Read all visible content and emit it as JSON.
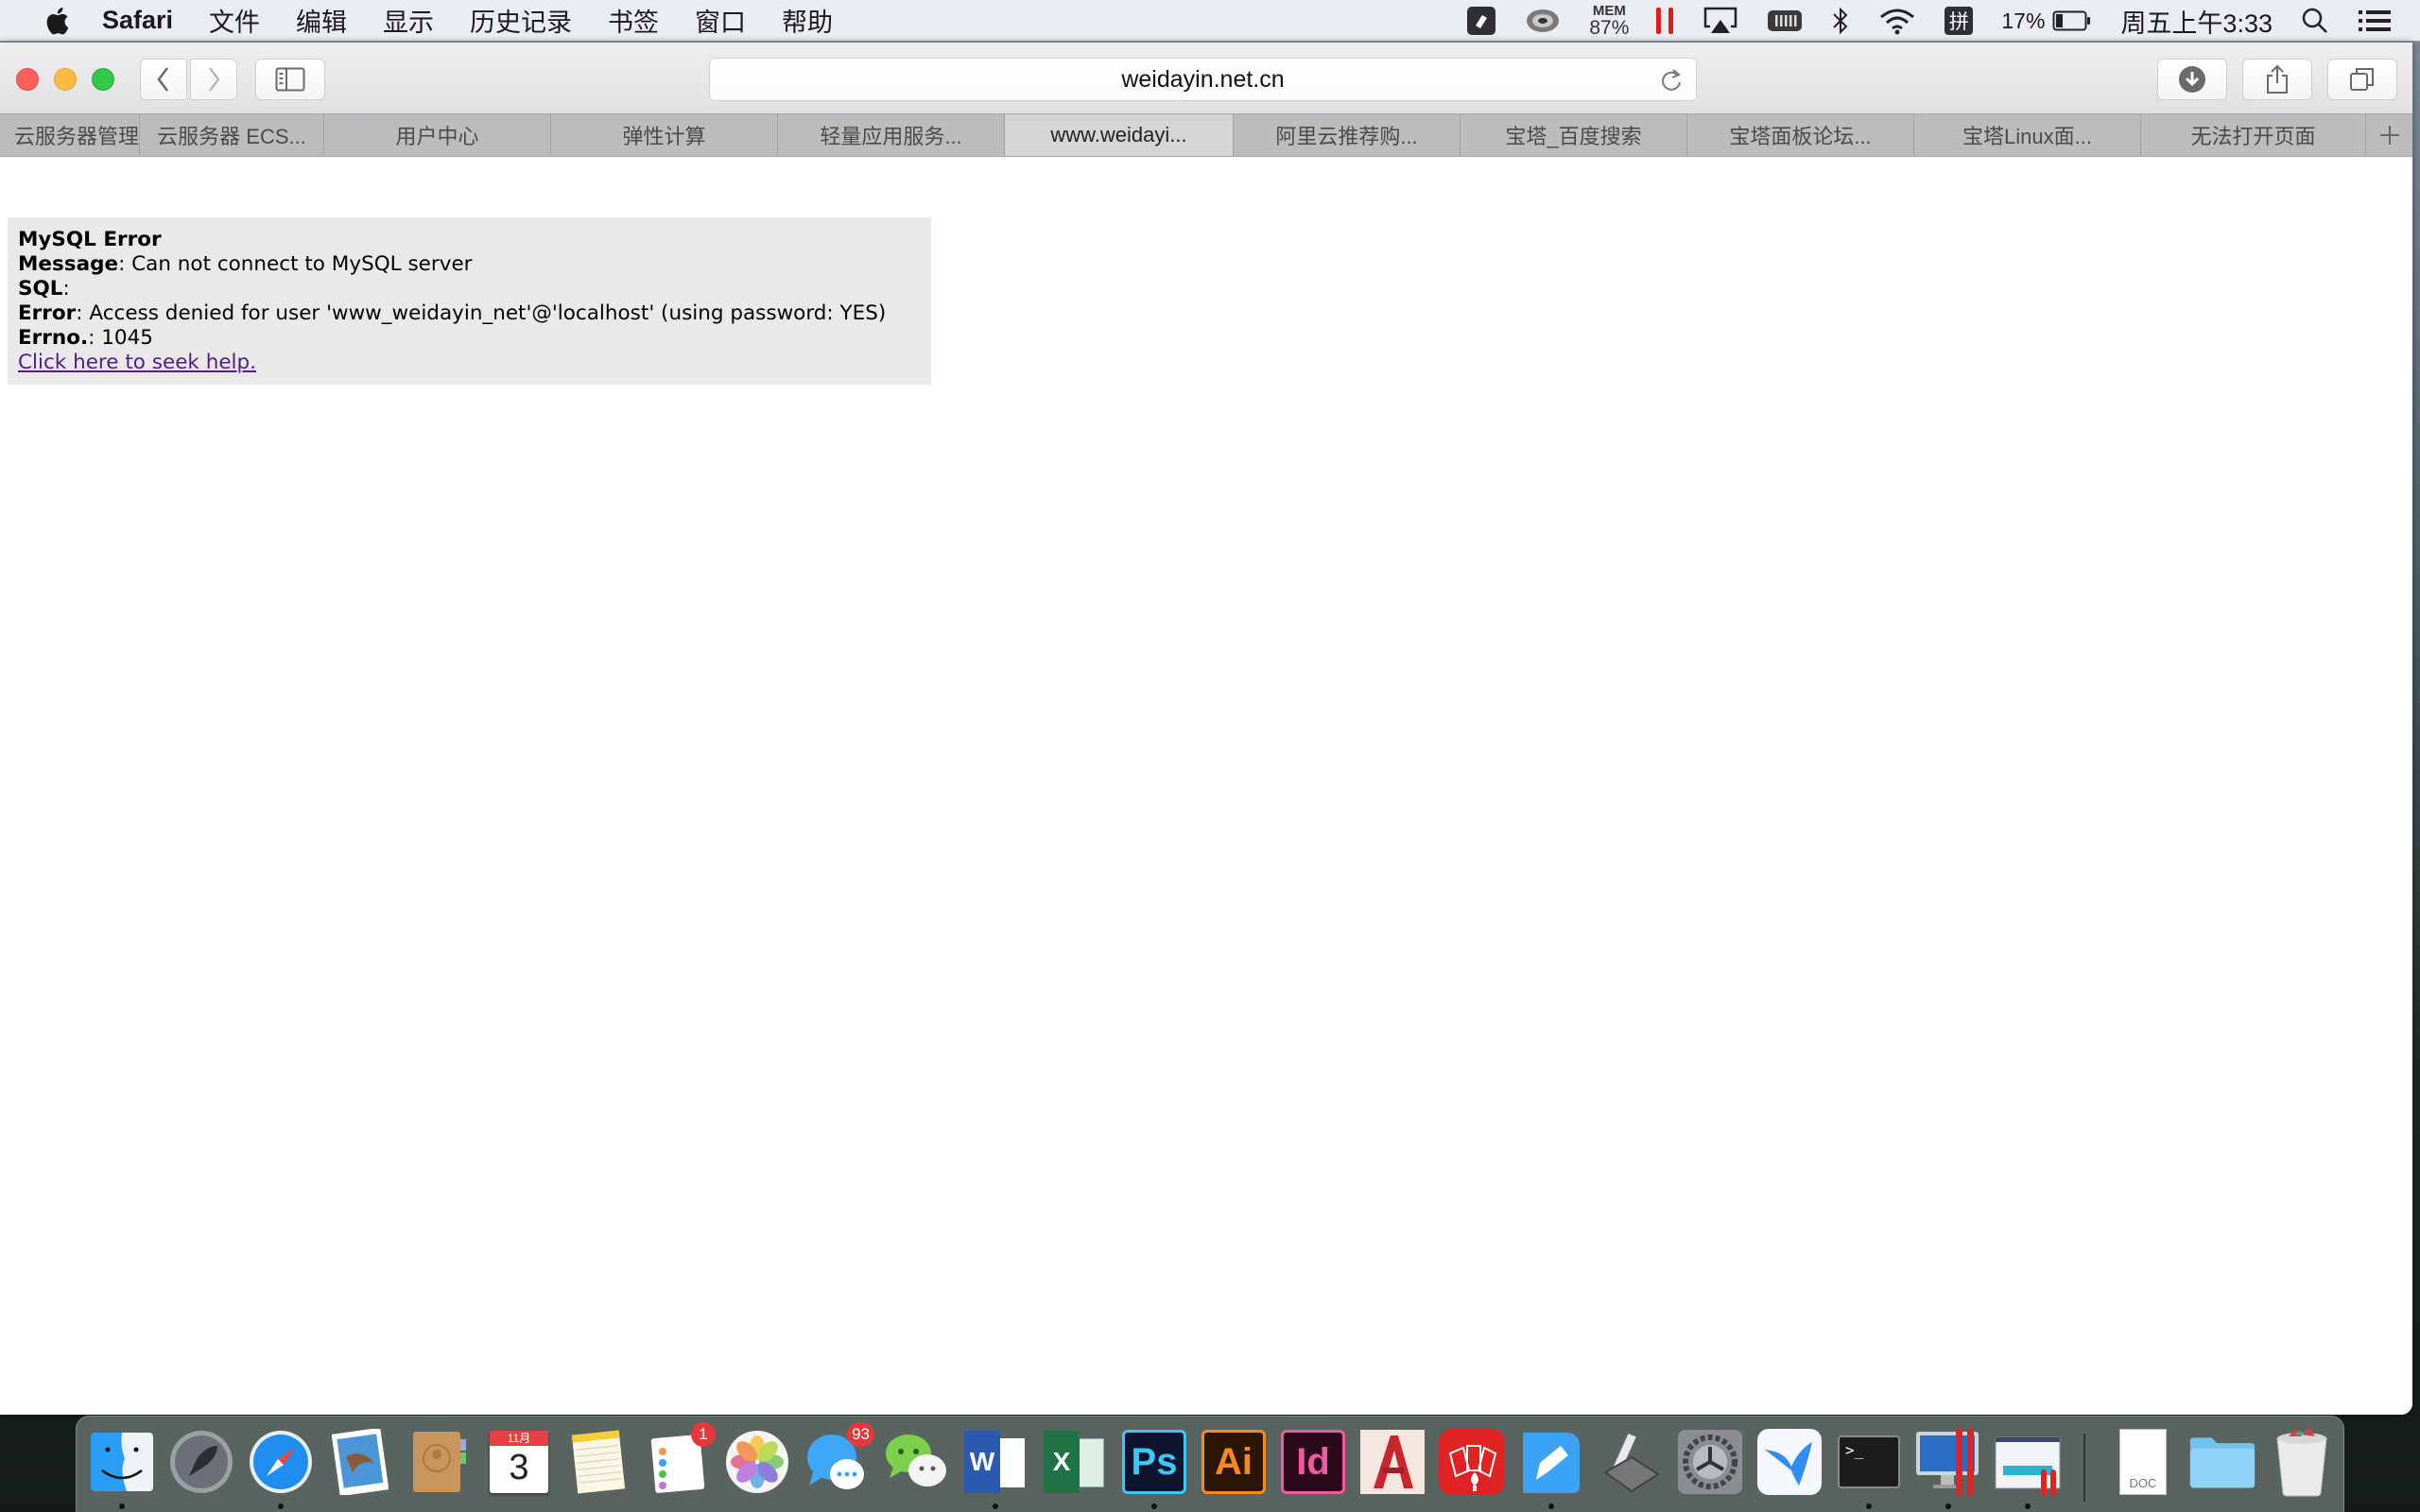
{
  "menubar": {
    "app_name": "Safari",
    "items": [
      "文件",
      "编辑",
      "显示",
      "历史记录",
      "书签",
      "窗口",
      "帮助"
    ],
    "status": {
      "mem_label": "MEM",
      "mem_value": "87%",
      "input_method": "拼",
      "battery_percent": "17%",
      "clock": "周五上午3:33"
    }
  },
  "browser": {
    "url": "weidayin.net.cn",
    "tabs": [
      {
        "label": "云服务器管理"
      },
      {
        "label": "云服务器 ECS..."
      },
      {
        "label": "用户中心"
      },
      {
        "label": "弹性计算"
      },
      {
        "label": "轻量应用服务..."
      },
      {
        "label": "www.weidayi...",
        "active": true
      },
      {
        "label": "阿里云推荐购..."
      },
      {
        "label": "宝塔_百度搜索"
      },
      {
        "label": "宝塔面板论坛..."
      },
      {
        "label": "宝塔Linux面..."
      },
      {
        "label": "无法打开页面"
      }
    ],
    "new_tab_symbol": "+"
  },
  "page": {
    "title": "MySQL Error",
    "rows": [
      {
        "label": "Message",
        "value": ": Can not connect to MySQL server"
      },
      {
        "label": "SQL",
        "value": ":"
      },
      {
        "label": "Error",
        "value": ": Access denied for user 'www_weidayin_net'@'localhost' (using password: YES)"
      },
      {
        "label": "Errno.",
        "value": ": 1045"
      }
    ],
    "help_link": "Click here to seek help."
  },
  "dock": {
    "calendar_month": "11月",
    "calendar_day": "3",
    "reminders_badge": "1",
    "messages_badge": "93",
    "ps_label": "Ps",
    "ai_label": "Ai",
    "id_label": "Id",
    "word_label": "W",
    "excel_label": "X",
    "doc_label": "DOC",
    "terminal_prompt": ">_"
  }
}
